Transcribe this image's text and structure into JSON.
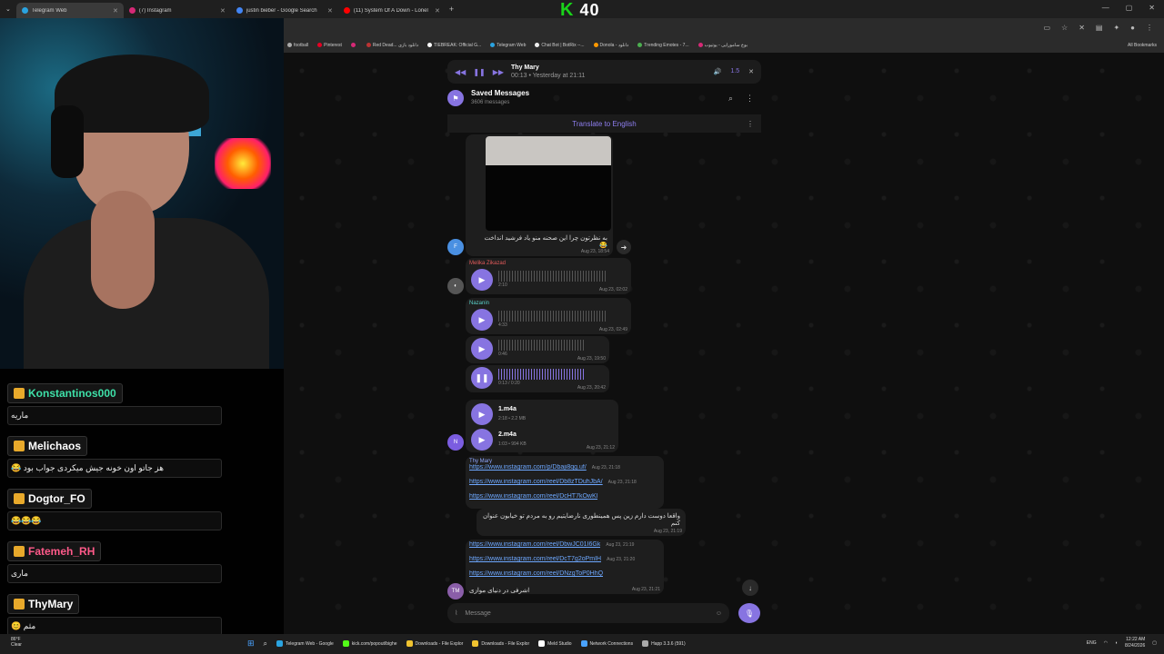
{
  "tabs": [
    {
      "title": "Telegram Web",
      "color": "#2aa3e0",
      "active": true
    },
    {
      "title": "(7) Instagram",
      "color": "#d62976",
      "active": false
    },
    {
      "title": "justin bieber - Google Search",
      "color": "#4285f4",
      "active": false
    },
    {
      "title": "(11) System Of A Down - Lonel",
      "color": "#ff0000",
      "active": false
    }
  ],
  "stream_logo": {
    "k": "K",
    "num": "40"
  },
  "bookmarks": [
    {
      "label": "football",
      "color": "#aaaaaa"
    },
    {
      "label": "Pinterest",
      "color": "#e60023"
    },
    {
      "label": "",
      "color": "#d62976"
    },
    {
      "label": "Red Dead... دانلود بازی",
      "color": "#b33"
    },
    {
      "label": "TIEBREAK: Official G...",
      "color": "#fff"
    },
    {
      "label": "Telegram Web",
      "color": "#2aa3e0"
    },
    {
      "label": "Chat Bot | BotRix --...",
      "color": "#eee"
    },
    {
      "label": "Donola - دانلود",
      "color": "#f90"
    },
    {
      "label": "Trending Emotes - 7...",
      "color": "#4caf50"
    },
    {
      "label": "بوخ سامورایی - یوتیوب",
      "color": "#d62976"
    }
  ],
  "all_bookmarks": "All Bookmarks",
  "chat": [
    {
      "user": "Konstantinos000",
      "color": "#3ee0a8",
      "text": "ماریه"
    },
    {
      "user": "Melichaos",
      "color": "#ffffff",
      "text": "هز جاتو اون خونه جیش میکردی جواب بود 😂"
    },
    {
      "user": "Dogtor_FO",
      "color": "#ffffff",
      "text": "😂😂😂"
    },
    {
      "user": "Fatemeh_RH",
      "color": "#ff5a8a",
      "text": "ماری"
    },
    {
      "user": "ThyMary",
      "color": "#ffffff",
      "text": "مثم 😊"
    }
  ],
  "player": {
    "title": "Thy Mary",
    "sub": "00:13 • Yesterday at 21:11",
    "speed": "1.5"
  },
  "header": {
    "title": "Saved Messages",
    "sub": "3606 messages"
  },
  "translate": "Translate to English",
  "caption": {
    "text": "به نظرتون چرا این صحنه منو یاد فرشید انداخت😂",
    "time": "Aug 23, 18:54",
    "avatar": "F"
  },
  "voice": [
    {
      "sender": "Melika Zikazad",
      "sender_color": "#e05a5a",
      "dur": "2:10",
      "time": "Aug 23, 02:02"
    },
    {
      "sender": "Nazanin",
      "sender_color": "#5ad0c9",
      "dur": "4:33",
      "time": "Aug 23, 02:49"
    },
    {
      "sender": "",
      "sender_color": "",
      "dur": "0:46",
      "time": "Aug 23, 19:50"
    },
    {
      "sender": "",
      "sender_color": "",
      "dur": "0:13 / 0:20",
      "time": "Aug 23, 20:42"
    }
  ],
  "files": [
    {
      "name": "1.m4a",
      "meta": "2:18 • 2.2 MB"
    },
    {
      "name": "2.m4a",
      "meta": "1:03 • 994 KB"
    }
  ],
  "files_time": "Aug 23, 21:12",
  "files_avatar": "N",
  "links_sender": "Thy Mary",
  "links": [
    {
      "url": "https://www.instagram.com/p/Dbaji8qg.uf/",
      "time": "Aug 23, 21:18"
    },
    {
      "url": "https://www.instagram.com/reel/Db8zTDuhJbA/",
      "time": "Aug 23, 21:18"
    },
    {
      "url": "https://www.instagram.com/reel/DcHT7kOwKl",
      "time": ""
    }
  ],
  "persian_msg": {
    "text": "واقعا دوست دارم زین پس همینطوری نارضایتیم رو به مردم تو خیابون عنوان کنم",
    "time": "Aug 23, 21:19"
  },
  "links2": [
    {
      "url": "https://www.instagram.com/reel/DbwJC01I6Gk",
      "time": "Aug 23, 21:19"
    },
    {
      "url": "https://www.instagram.com/reel/DcT7g2oPmIH",
      "time": "Aug 23, 21:20"
    },
    {
      "url": "https://www.instagram.com/reel/DNzgToP0HhQ",
      "time": ""
    }
  ],
  "last_msg": {
    "text": "اشرفی در دنیای موازی",
    "time": "Aug 23, 21:21",
    "avatar": "TM"
  },
  "compose_placeholder": "Message",
  "taskbar": {
    "weather_temp": "86°F",
    "weather_desc": "Clear",
    "apps": [
      {
        "label": "Telegram Web - Google",
        "color": "#2aa3e0"
      },
      {
        "label": "kick.com/popout/bighe",
        "color": "#53fc18"
      },
      {
        "label": "Downloads - File Explor",
        "color": "#f0c330"
      },
      {
        "label": "Downloads - File Explor",
        "color": "#f0c330"
      },
      {
        "label": "Meld Studio",
        "color": "#fff"
      },
      {
        "label": "Network Connections",
        "color": "#4aa3ff"
      },
      {
        "label": "Happ 3.3.6 (591)",
        "color": "#aaa"
      }
    ],
    "lang": "ENG",
    "time": "12:22 AM",
    "date": "8/24/2026"
  }
}
